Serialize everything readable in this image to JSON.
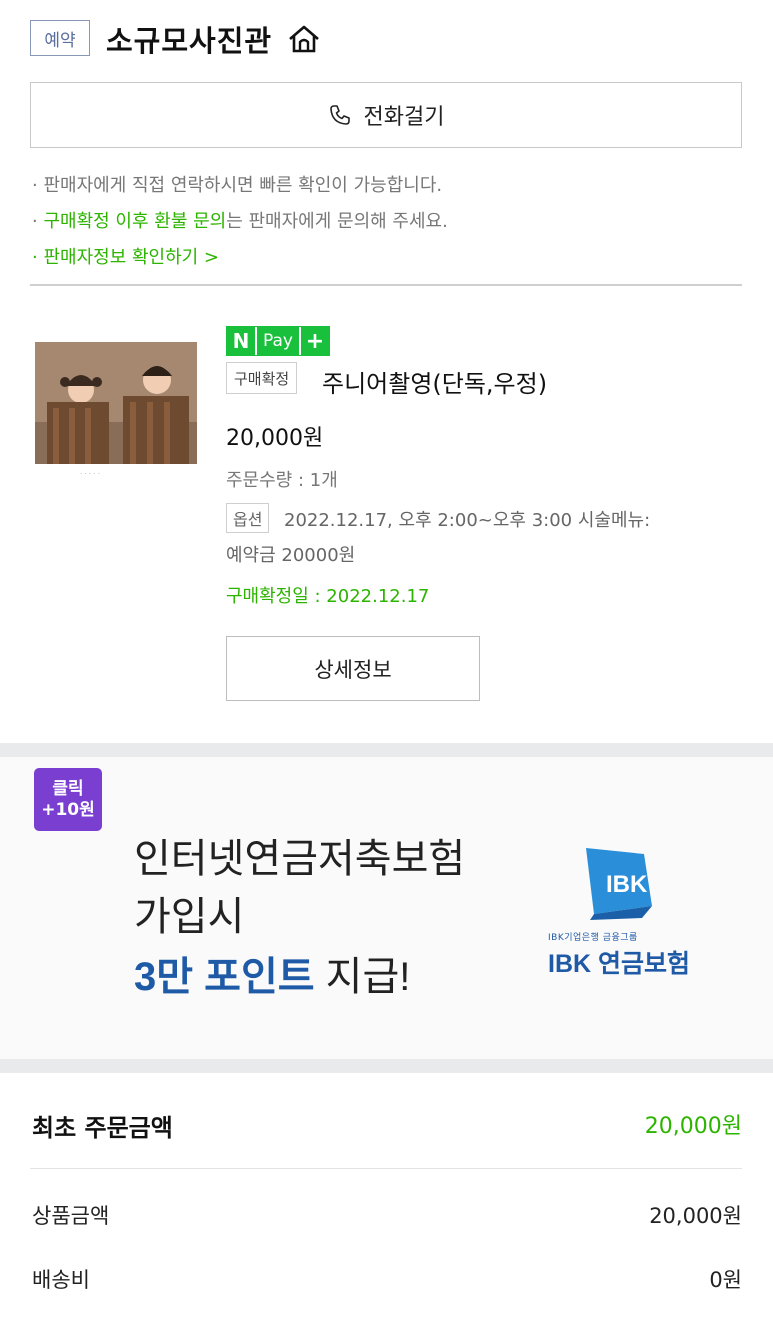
{
  "header": {
    "reservation_badge": "예약",
    "shop_name": "소규모사진관",
    "call_button": "전화걸기"
  },
  "notes": {
    "line1": "판매자에게 직접 연락하시면 빠른 확인이 가능합니다.",
    "line2_highlight": "구매확정 이후 환불 문의",
    "line2_rest": "는 판매자에게 문의해 주세요.",
    "seller_info_link": "판매자정보 확인하기 >"
  },
  "order_item": {
    "npay_n": "N",
    "npay_pay": "Pay",
    "npay_plus": "+",
    "status_tag": "구매확정",
    "product_name": "주니어촬영(단독,우정)",
    "price": "20,000원",
    "quantity": "주문수량 : 1개",
    "option_tag": "옵션",
    "option_text": "2022.12.17, 오후 2:00~오후 3:00 시술메뉴:",
    "option_text2": "예약금 20000원",
    "confirm_date": "구매확정일 : 2022.12.17",
    "detail_button": "상세정보"
  },
  "ad": {
    "click_badge_line1": "클릭",
    "click_badge_line2": "+10원",
    "line1": "인터넷연금저축보험",
    "line2": "가입시",
    "line3_highlight": "3만 포인트",
    "line3_rest": " 지급!",
    "brand_small": "IBK기업은행 금융그룹",
    "brand": "IBK 연금보험",
    "colors": {
      "badge": "#7a3fd1",
      "brand_blue": "#1f5aa6"
    }
  },
  "summary": {
    "title": "최초 주문금액",
    "total": "20,000원",
    "rows": [
      {
        "label": "상품금액",
        "value": "20,000원"
      },
      {
        "label": "배송비",
        "value": "0원"
      }
    ]
  },
  "colors": {
    "accent_green": "#2db400"
  }
}
